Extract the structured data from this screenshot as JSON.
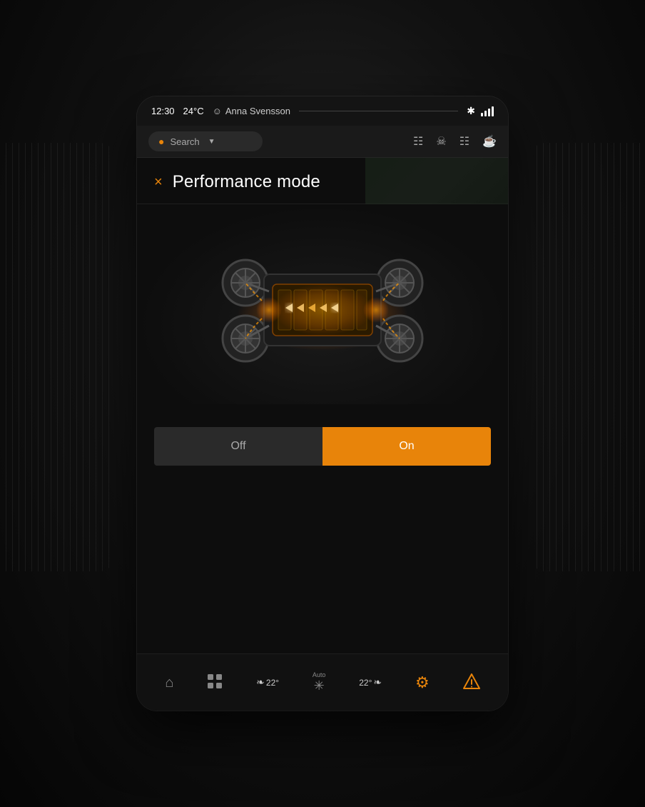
{
  "car_interior": {
    "background": "dark"
  },
  "status_bar": {
    "time": "12:30",
    "temperature": "24°C",
    "user_icon": "person",
    "user_name": "Anna Svensson",
    "bluetooth_icon": "bluetooth",
    "signal_icon": "signal"
  },
  "nav_bar": {
    "search_placeholder": "Search",
    "map_icon": "map-pin",
    "gas_icon": "gas-station",
    "restaurant_icon": "fork-knife",
    "shopping_icon": "shopping-cart",
    "coffee_icon": "coffee"
  },
  "performance_mode": {
    "close_label": "×",
    "title": "Performance mode",
    "toggle": {
      "off_label": "Off",
      "on_label": "On",
      "current_state": "on"
    }
  },
  "bottom_nav": {
    "home_label": "",
    "apps_label": "",
    "climate_left_label": "22°",
    "climate_auto_label": "Auto",
    "fan_label": "",
    "climate_right_label": "22°",
    "settings_label": "",
    "warning_label": ""
  }
}
